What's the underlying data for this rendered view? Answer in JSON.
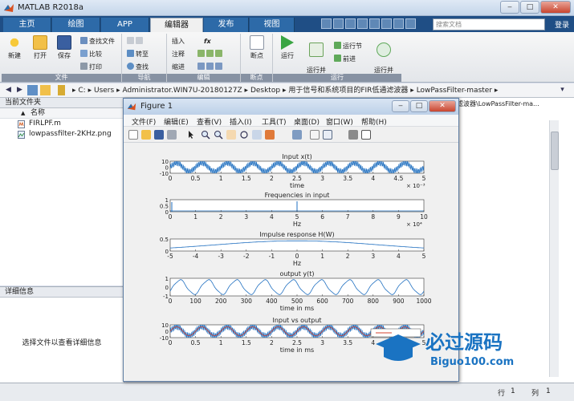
{
  "app": {
    "title": "MATLAB R2018a",
    "window_buttons": {
      "minimize": "‒",
      "maximize": "□",
      "close": "✕"
    }
  },
  "ribbon": {
    "tabs": [
      "主页",
      "绘图",
      "APP",
      "编辑器",
      "发布",
      "视图"
    ],
    "active_tab": "编辑器",
    "search_placeholder": "搜索文档",
    "login": "登录",
    "groups": {
      "file": {
        "label": "文件",
        "new": "新建",
        "open": "打开",
        "save": "保存",
        "find_files": "查找文件",
        "compare": "比较",
        "print": "打印"
      },
      "navigate": {
        "label": "导航",
        "goto": "转至",
        "find": "查找"
      },
      "edit": {
        "label": "编辑",
        "insert": "插入",
        "comment": "注释",
        "indent": "缩进",
        "fx": "fx"
      },
      "breakpoints": {
        "label": "断点",
        "breakpoints": "断点"
      },
      "run": {
        "label": "运行",
        "run": "运行",
        "run_advance": "运行并\n前进",
        "run_section": "运行节",
        "advance": "前进",
        "run_time": "运行并\n计时"
      }
    }
  },
  "address": {
    "path": [
      "C:",
      "Users",
      "Administrator.WIN7U-20180127Z",
      "Desktop",
      "用于信号和系统项目的FIR低通滤波器",
      "LowPassFilter-master"
    ],
    "right_path": "滤波器\\LowPassFilter-ma..."
  },
  "current_folder": {
    "title": "当前文件夹",
    "column_name": "名称",
    "sort_arrow": "▲",
    "files": [
      {
        "name": "FIRLPF.m",
        "type": "m"
      },
      {
        "name": "lowpassfilter-2KHz.png",
        "type": "png"
      }
    ]
  },
  "details": {
    "title": "详细信息",
    "message": "选择文件以查看详细信息"
  },
  "status": {
    "row_label": "行",
    "row": "1",
    "col_label": "列",
    "col": "1"
  },
  "figure": {
    "title": "Figure 1",
    "menu": [
      "文件(F)",
      "编辑(E)",
      "查看(V)",
      "插入(I)",
      "工具(T)",
      "桌面(D)",
      "窗口(W)",
      "帮助(H)"
    ],
    "subplots": [
      {
        "title": "Input x(t)",
        "xlabel": "time",
        "xticks": [
          "0",
          "0.5",
          "1",
          "1.5",
          "2",
          "2.5",
          "3",
          "3.5",
          "4",
          "4.5",
          "5"
        ],
        "yticks": [
          "10",
          "0",
          "-10"
        ],
        "exponent": "× 10⁻³"
      },
      {
        "title": "Frequencies in input",
        "xlabel": "Hz",
        "xticks": [
          "0",
          "1",
          "2",
          "3",
          "4",
          "5",
          "6",
          "7",
          "8",
          "9",
          "10"
        ],
        "yticks": [
          "1",
          "0.5",
          "0"
        ],
        "exponent": "× 10⁴"
      },
      {
        "title": "Impulse response H(W)",
        "xlabel": "Hz",
        "xticks": [
          "-5",
          "-4",
          "-3",
          "-2",
          "-1",
          "0",
          "1",
          "2",
          "3",
          "4",
          "5"
        ],
        "yticks": [
          "0.5",
          "0"
        ]
      },
      {
        "title": "output y(t)",
        "xlabel": "time in ms",
        "xticks": [
          "0",
          "100",
          "200",
          "300",
          "400",
          "500",
          "600",
          "700",
          "800",
          "900",
          "1000"
        ],
        "yticks": [
          "1",
          "0",
          "-1"
        ]
      },
      {
        "title": "Input vs output",
        "xlabel": "time in ms",
        "xticks": [
          "0",
          "0.5",
          "1",
          "1.5",
          "2",
          "2.5",
          "3",
          "3.5",
          "4",
          "4.5",
          "5"
        ],
        "yticks": [
          "10",
          "0",
          "-10"
        ]
      }
    ]
  },
  "watermark": {
    "brand": "必过源码",
    "url": "Biguo100.com"
  },
  "colors": {
    "plot_blue": "#1f6fc0",
    "plot_red": "#d4402c",
    "ribbon_dark": "#1f4e85",
    "figure_bg": "#f0f0f0"
  }
}
